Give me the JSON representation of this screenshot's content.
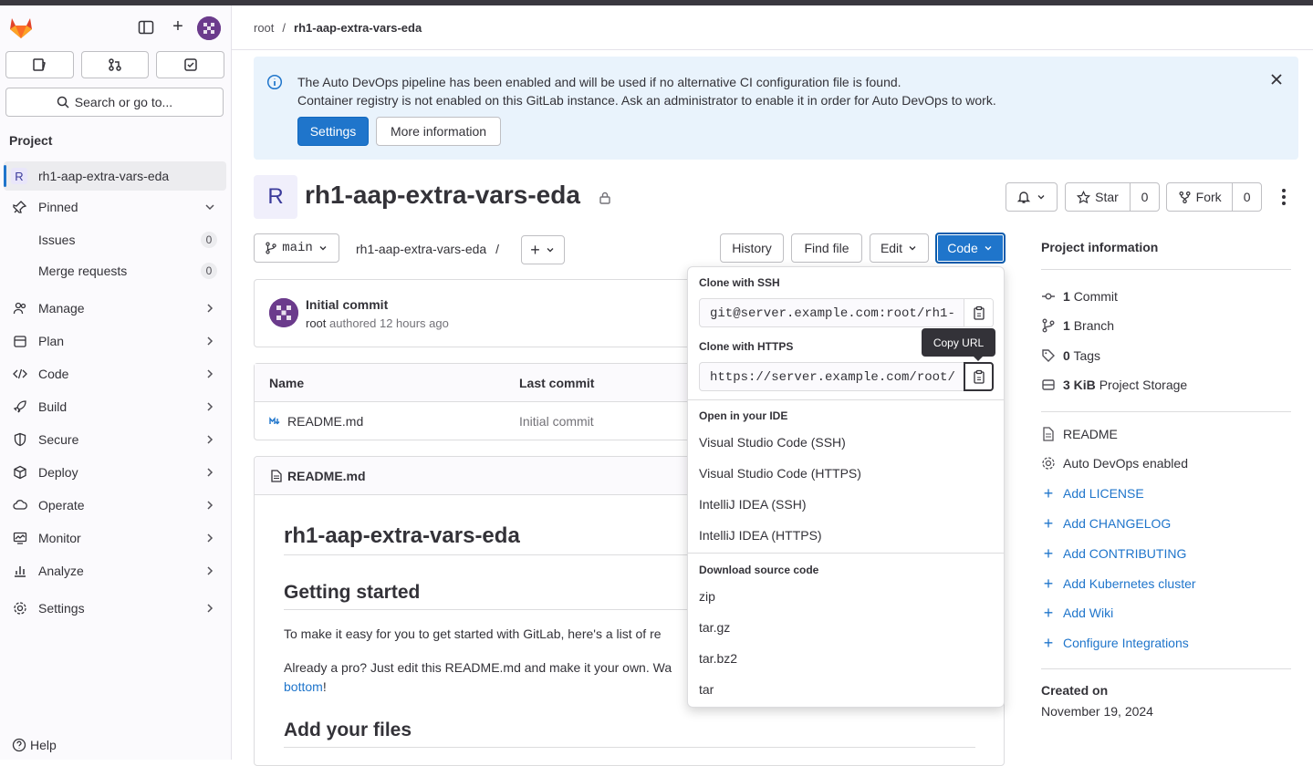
{
  "sidebar": {
    "search_label": "Search or go to...",
    "heading": "Project",
    "project_name": "rh1-aap-extra-vars-eda",
    "project_initial": "R",
    "pinned_label": "Pinned",
    "issues_label": "Issues",
    "issues_count": "0",
    "mr_label": "Merge requests",
    "mr_count": "0",
    "items": [
      {
        "label": "Manage",
        "icon": "users-icon"
      },
      {
        "label": "Plan",
        "icon": "calendar-icon"
      },
      {
        "label": "Code",
        "icon": "code-icon"
      },
      {
        "label": "Build",
        "icon": "rocket-icon"
      },
      {
        "label": "Secure",
        "icon": "shield-icon"
      },
      {
        "label": "Deploy",
        "icon": "deployments-icon"
      },
      {
        "label": "Operate",
        "icon": "cloud-gear-icon"
      },
      {
        "label": "Monitor",
        "icon": "monitor-icon"
      },
      {
        "label": "Analyze",
        "icon": "chart-icon"
      },
      {
        "label": "Settings",
        "icon": "gear-icon"
      }
    ],
    "help_label": "Help"
  },
  "breadcrumb": {
    "root": "root",
    "sep": "/",
    "current": "rh1-aap-extra-vars-eda"
  },
  "alert": {
    "line1": "The Auto DevOps pipeline has been enabled and will be used if no alternative CI configuration file is found.",
    "line2": "Container registry is not enabled on this GitLab instance. Ask an administrator to enable it in order for Auto DevOps to work.",
    "settings_label": "Settings",
    "more_info_label": "More information"
  },
  "project": {
    "initial": "R",
    "title": "rh1-aap-extra-vars-eda",
    "star_label": "Star",
    "star_count": "0",
    "fork_label": "Fork",
    "fork_count": "0"
  },
  "repo": {
    "branch": "main",
    "path": "rh1-aap-extra-vars-eda",
    "path_sep": "/",
    "history_label": "History",
    "find_file_label": "Find file",
    "edit_label": "Edit",
    "code_label": "Code"
  },
  "commit": {
    "title": "Initial commit",
    "author": "root",
    "meta": "authored 12 hours ago"
  },
  "files": {
    "col_name": "Name",
    "col_last_commit": "Last commit",
    "rows": [
      {
        "name": "README.md",
        "commit": "Initial commit"
      }
    ]
  },
  "readme": {
    "filename": "README.md",
    "h1": "rh1-aap-extra-vars-eda",
    "h2_started": "Getting started",
    "p1": "To make it easy for you to get started with GitLab, here's a list of re",
    "p2": "Already a pro? Just edit this README.md and make it your own. Wa",
    "p3_link": "bottom",
    "p3_tail": "!",
    "h2_files": "Add your files"
  },
  "clone": {
    "ssh_label": "Clone with SSH",
    "ssh_url": "git@server.example.com:root/rh1-",
    "https_label": "Clone with HTTPS",
    "https_url": "https://server.example.com/root/",
    "tooltip": "Copy URL",
    "ide_label": "Open in your IDE",
    "ide_items": [
      "Visual Studio Code (SSH)",
      "Visual Studio Code (HTTPS)",
      "IntelliJ IDEA (SSH)",
      "IntelliJ IDEA (HTTPS)"
    ],
    "download_label": "Download source code",
    "download_items": [
      "zip",
      "tar.gz",
      "tar.bz2",
      "tar"
    ]
  },
  "info": {
    "title": "Project information",
    "commits_n": "1",
    "commits_l": "Commit",
    "branches_n": "1",
    "branches_l": "Branch",
    "tags_n": "0",
    "tags_l": "Tags",
    "storage_n": "3 KiB",
    "storage_l": "Project Storage",
    "readme": "README",
    "autodevops": "Auto DevOps enabled",
    "links": [
      "Add LICENSE",
      "Add CHANGELOG",
      "Add CONTRIBUTING",
      "Add Kubernetes cluster",
      "Add Wiki",
      "Configure Integrations"
    ],
    "created_label": "Created on",
    "created_value": "November 19, 2024"
  },
  "colors": {
    "accent": "#1f75cb",
    "brand": "#e24329",
    "alert_bg": "#e9f3fc"
  }
}
